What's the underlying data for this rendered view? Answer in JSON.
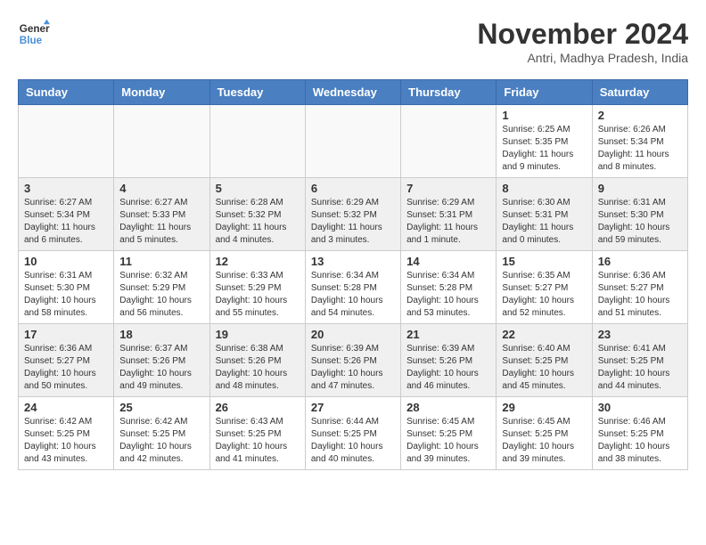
{
  "header": {
    "logo_line1": "General",
    "logo_line2": "Blue",
    "month_year": "November 2024",
    "location": "Antri, Madhya Pradesh, India"
  },
  "weekdays": [
    "Sunday",
    "Monday",
    "Tuesday",
    "Wednesday",
    "Thursday",
    "Friday",
    "Saturday"
  ],
  "weeks": [
    [
      {
        "day": "",
        "info": ""
      },
      {
        "day": "",
        "info": ""
      },
      {
        "day": "",
        "info": ""
      },
      {
        "day": "",
        "info": ""
      },
      {
        "day": "",
        "info": ""
      },
      {
        "day": "1",
        "info": "Sunrise: 6:25 AM\nSunset: 5:35 PM\nDaylight: 11 hours and 9 minutes."
      },
      {
        "day": "2",
        "info": "Sunrise: 6:26 AM\nSunset: 5:34 PM\nDaylight: 11 hours and 8 minutes."
      }
    ],
    [
      {
        "day": "3",
        "info": "Sunrise: 6:27 AM\nSunset: 5:34 PM\nDaylight: 11 hours and 6 minutes."
      },
      {
        "day": "4",
        "info": "Sunrise: 6:27 AM\nSunset: 5:33 PM\nDaylight: 11 hours and 5 minutes."
      },
      {
        "day": "5",
        "info": "Sunrise: 6:28 AM\nSunset: 5:32 PM\nDaylight: 11 hours and 4 minutes."
      },
      {
        "day": "6",
        "info": "Sunrise: 6:29 AM\nSunset: 5:32 PM\nDaylight: 11 hours and 3 minutes."
      },
      {
        "day": "7",
        "info": "Sunrise: 6:29 AM\nSunset: 5:31 PM\nDaylight: 11 hours and 1 minute."
      },
      {
        "day": "8",
        "info": "Sunrise: 6:30 AM\nSunset: 5:31 PM\nDaylight: 11 hours and 0 minutes."
      },
      {
        "day": "9",
        "info": "Sunrise: 6:31 AM\nSunset: 5:30 PM\nDaylight: 10 hours and 59 minutes."
      }
    ],
    [
      {
        "day": "10",
        "info": "Sunrise: 6:31 AM\nSunset: 5:30 PM\nDaylight: 10 hours and 58 minutes."
      },
      {
        "day": "11",
        "info": "Sunrise: 6:32 AM\nSunset: 5:29 PM\nDaylight: 10 hours and 56 minutes."
      },
      {
        "day": "12",
        "info": "Sunrise: 6:33 AM\nSunset: 5:29 PM\nDaylight: 10 hours and 55 minutes."
      },
      {
        "day": "13",
        "info": "Sunrise: 6:34 AM\nSunset: 5:28 PM\nDaylight: 10 hours and 54 minutes."
      },
      {
        "day": "14",
        "info": "Sunrise: 6:34 AM\nSunset: 5:28 PM\nDaylight: 10 hours and 53 minutes."
      },
      {
        "day": "15",
        "info": "Sunrise: 6:35 AM\nSunset: 5:27 PM\nDaylight: 10 hours and 52 minutes."
      },
      {
        "day": "16",
        "info": "Sunrise: 6:36 AM\nSunset: 5:27 PM\nDaylight: 10 hours and 51 minutes."
      }
    ],
    [
      {
        "day": "17",
        "info": "Sunrise: 6:36 AM\nSunset: 5:27 PM\nDaylight: 10 hours and 50 minutes."
      },
      {
        "day": "18",
        "info": "Sunrise: 6:37 AM\nSunset: 5:26 PM\nDaylight: 10 hours and 49 minutes."
      },
      {
        "day": "19",
        "info": "Sunrise: 6:38 AM\nSunset: 5:26 PM\nDaylight: 10 hours and 48 minutes."
      },
      {
        "day": "20",
        "info": "Sunrise: 6:39 AM\nSunset: 5:26 PM\nDaylight: 10 hours and 47 minutes."
      },
      {
        "day": "21",
        "info": "Sunrise: 6:39 AM\nSunset: 5:26 PM\nDaylight: 10 hours and 46 minutes."
      },
      {
        "day": "22",
        "info": "Sunrise: 6:40 AM\nSunset: 5:25 PM\nDaylight: 10 hours and 45 minutes."
      },
      {
        "day": "23",
        "info": "Sunrise: 6:41 AM\nSunset: 5:25 PM\nDaylight: 10 hours and 44 minutes."
      }
    ],
    [
      {
        "day": "24",
        "info": "Sunrise: 6:42 AM\nSunset: 5:25 PM\nDaylight: 10 hours and 43 minutes."
      },
      {
        "day": "25",
        "info": "Sunrise: 6:42 AM\nSunset: 5:25 PM\nDaylight: 10 hours and 42 minutes."
      },
      {
        "day": "26",
        "info": "Sunrise: 6:43 AM\nSunset: 5:25 PM\nDaylight: 10 hours and 41 minutes."
      },
      {
        "day": "27",
        "info": "Sunrise: 6:44 AM\nSunset: 5:25 PM\nDaylight: 10 hours and 40 minutes."
      },
      {
        "day": "28",
        "info": "Sunrise: 6:45 AM\nSunset: 5:25 PM\nDaylight: 10 hours and 39 minutes."
      },
      {
        "day": "29",
        "info": "Sunrise: 6:45 AM\nSunset: 5:25 PM\nDaylight: 10 hours and 39 minutes."
      },
      {
        "day": "30",
        "info": "Sunrise: 6:46 AM\nSunset: 5:25 PM\nDaylight: 10 hours and 38 minutes."
      }
    ]
  ]
}
